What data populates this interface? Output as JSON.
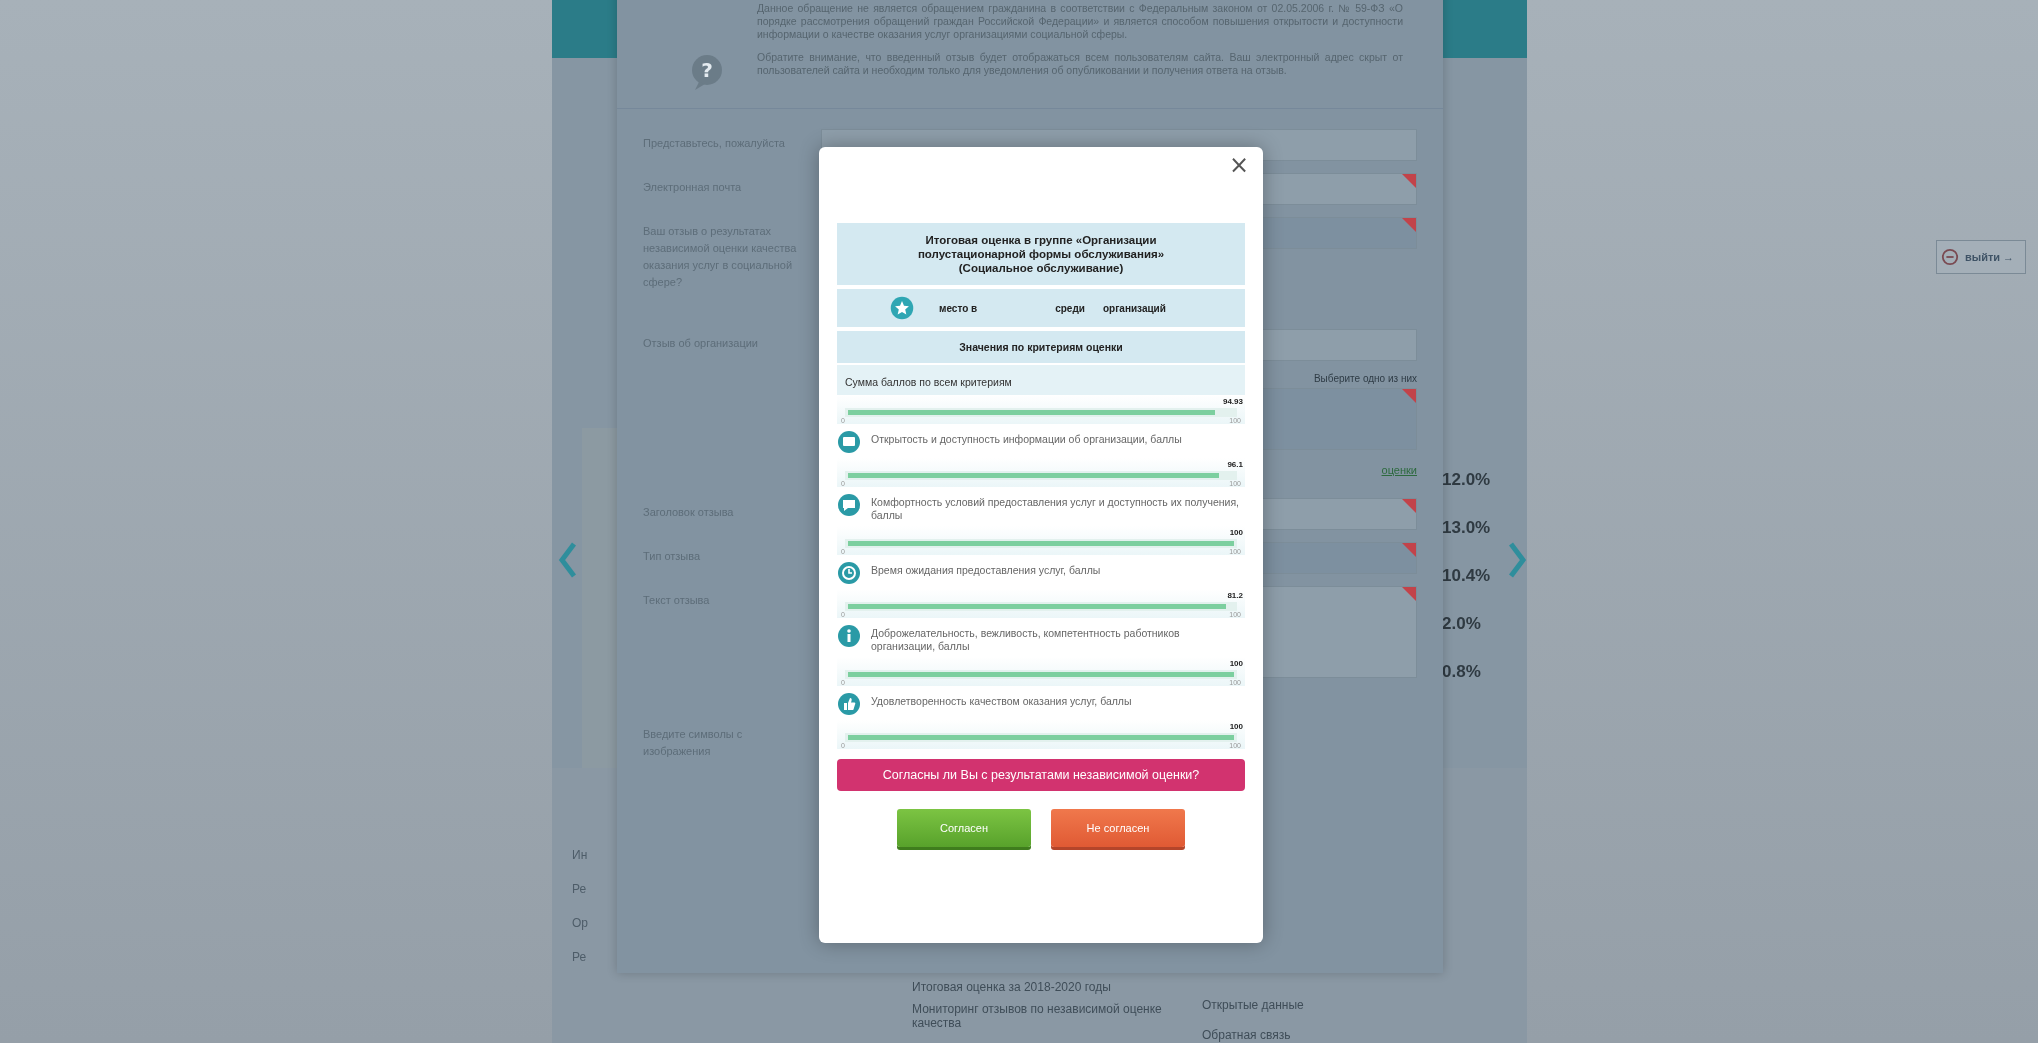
{
  "page": {
    "percentages": [
      "12.0%",
      "13.0%",
      "10.4%",
      "2.0%",
      "0.8%"
    ],
    "footer_left": [
      "Ин",
      "Ре",
      "Ор",
      "Ре"
    ],
    "footer_links": [
      "Итоговая оценка за 2018-2020 годы",
      "Мониторинг отзывов по независимой оценке качества"
    ],
    "footer_right": [
      "Открытые данные",
      "Обратная связь"
    ],
    "logout": "выйти →"
  },
  "feedback_form": {
    "notice_icon": "?",
    "notice": [
      "Данное обращение не является обращением гражданина в соответствии с Федеральным законом от 02.05.2006 г. № 59-ФЗ «О порядке рассмотрения обращений граждан Российской Федерации» и является способом повышения открытости и доступности информации о качестве оказания услуг организациями социальной сферы.",
      "Обратите внимание, что введенный отзыв будет отображаться всем пользователям сайта. Ваш электронный адрес скрыт от пользователей сайта и необходим только для уведомления об опубликовании и получения ответа на отзыв."
    ],
    "fields": [
      {
        "kind": "input",
        "label": "Представьтесь, пожалуйста",
        "required": false
      },
      {
        "kind": "input",
        "label": "Электронная почта",
        "required": true
      },
      {
        "kind": "select",
        "label": "Ваш отзыв о результатах независимой оценки качества оказания услуг в социальной сфере?",
        "required": true
      },
      {
        "kind": "input",
        "label": "Отзыв об организации",
        "required": false
      },
      {
        "kind": "choice",
        "hint": "Выберите одно из них",
        "link": "оценки",
        "required": true
      },
      {
        "kind": "input",
        "label": "Заголовок отзыва",
        "required": true
      },
      {
        "kind": "select",
        "label": "Тип отзыва",
        "required": true
      },
      {
        "kind": "textarea",
        "label": "Текст отзыва",
        "required": true
      },
      {
        "kind": "captcha",
        "label": "Введите символы с изображения",
        "required": false
      }
    ]
  },
  "modal": {
    "close": "×",
    "title": "Итоговая оценка в группе «Организации полустационарной формы обслуживания» (Социальное обслуживание)",
    "rank": [
      "место в",
      "среди",
      "организаций"
    ],
    "section": "Значения по критериям оценки",
    "criteria": [
      {
        "kind": "total",
        "label": "Сумма баллов по всем критериям",
        "value": "94.93",
        "level": 0.95,
        "min": "0",
        "max": "100"
      },
      {
        "kind": "info",
        "label": "Открытость и доступность информации об организации, баллы",
        "value": "96.1",
        "level": 0.96,
        "min": "0",
        "max": "100"
      },
      {
        "kind": "comfort",
        "label": "Комфортность условий предоставления услуг и доступность их получения, баллы",
        "value": "100",
        "level": 1,
        "min": "0",
        "max": "100"
      },
      {
        "kind": "time",
        "label": "Время ожидания предоставления услуг, баллы",
        "value": "81.2",
        "level": 0.98,
        "min": "0",
        "max": "100"
      },
      {
        "kind": "staff",
        "label": "Доброжелательность, вежливость, компетентность работников организации, баллы",
        "value": "100",
        "level": 1,
        "min": "0",
        "max": "100"
      },
      {
        "kind": "satisfaction",
        "label": "Удовлетворенность качеством оказания услуг, баллы",
        "value": "100",
        "level": 1,
        "min": "0",
        "max": "100"
      }
    ],
    "question": "Согласны ли Вы с результатами независимой оценки?",
    "buttons": [
      {
        "kind": "agree",
        "label": "Согласен"
      },
      {
        "kind": "disagree",
        "label": "Не согласен"
      }
    ]
  }
}
